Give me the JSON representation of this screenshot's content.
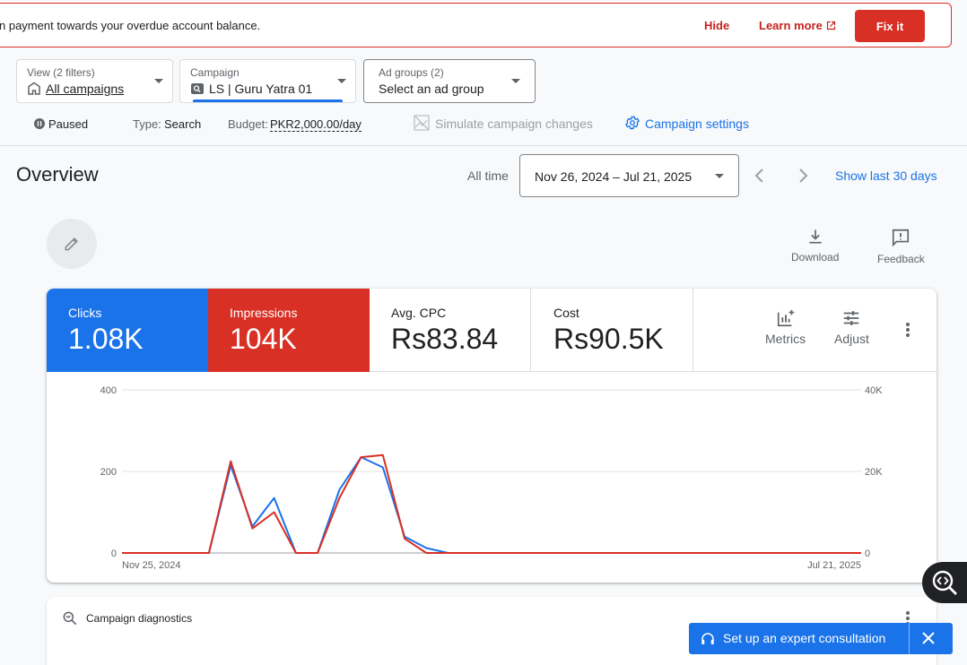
{
  "alert": {
    "message": "n payment towards your overdue account balance.",
    "hide": "Hide",
    "learn_more": "Learn more",
    "fix_it": "Fix it"
  },
  "filters": {
    "view": {
      "label": "View (2 filters)",
      "value": "All campaigns"
    },
    "campaign": {
      "label": "Campaign",
      "value": "LS | Guru Yatra 01"
    },
    "ad_groups": {
      "label": "Ad groups (2)",
      "value": "Select an ad group"
    }
  },
  "status": {
    "state": "Paused",
    "type_label": "Type:",
    "type_value": "Search",
    "budget_label": "Budget:",
    "budget_value": "PKR2,000.00/day",
    "simulate": "Simulate campaign changes",
    "settings": "Campaign settings"
  },
  "overview": {
    "title": "Overview",
    "all_time": "All time",
    "date_range": "Nov 26, 2024 – Jul 21, 2025",
    "show_last": "Show last 30 days",
    "download": "Download",
    "feedback": "Feedback"
  },
  "scorecards": [
    {
      "label": "Clicks",
      "value": "1.08K"
    },
    {
      "label": "Impressions",
      "value": "104K"
    },
    {
      "label": "Avg. CPC",
      "value": "Rs83.84"
    },
    {
      "label": "Cost",
      "value": "Rs90.5K"
    }
  ],
  "card_tools": {
    "metrics": "Metrics",
    "adjust": "Adjust"
  },
  "chart_data": {
    "type": "line",
    "x_start_label": "Nov 25, 2024",
    "x_end_label": "Jul 21, 2025",
    "y_left_ticks": [
      "400",
      "200",
      "0"
    ],
    "y_right_ticks": [
      "40K",
      "20K",
      "0"
    ],
    "ylim_left": [
      0,
      400
    ],
    "ylim_right": [
      0,
      40000
    ],
    "series": [
      {
        "name": "Clicks",
        "color": "#1a73e8",
        "axis": "left",
        "values": [
          0,
          0,
          0,
          0,
          0,
          215,
          65,
          135,
          0,
          0,
          155,
          235,
          210,
          40,
          12,
          0,
          0,
          0,
          0,
          0,
          0,
          0,
          0,
          0,
          0,
          0,
          0,
          0,
          0,
          0,
          0,
          0,
          0,
          0,
          0
        ]
      },
      {
        "name": "Impressions",
        "color": "#d93025",
        "axis": "right",
        "values": [
          0,
          0,
          0,
          0,
          0,
          22500,
          6000,
          10000,
          0,
          0,
          13500,
          23500,
          24000,
          3500,
          0,
          0,
          0,
          0,
          0,
          0,
          0,
          0,
          0,
          0,
          0,
          0,
          0,
          0,
          0,
          0,
          0,
          0,
          0,
          0,
          0
        ]
      }
    ]
  },
  "diagnostics": {
    "title": "Campaign diagnostics"
  },
  "consult": {
    "label": "Set up an expert consultation"
  },
  "colors": {
    "accent": "#1a73e8",
    "danger": "#d93025"
  }
}
